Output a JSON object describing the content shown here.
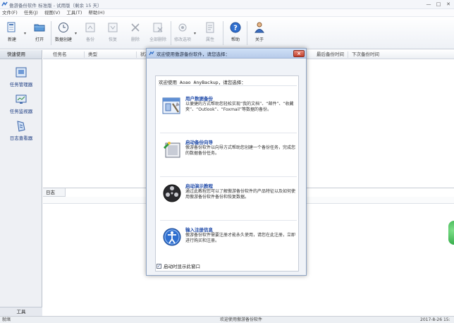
{
  "window": {
    "title": "傲游备份软件 标准版 - 试用版（剩余 15 天）",
    "controls": [
      "—",
      "□",
      "✕"
    ]
  },
  "menu": [
    "文件(F)",
    "任务(J)",
    "视图(V)",
    "工具(T)",
    "帮助(H)"
  ],
  "toolbar": {
    "buttons": [
      {
        "label": "新建",
        "icon": "new-task-icon",
        "disabled": false
      },
      {
        "label": "打开",
        "icon": "open-folder-icon",
        "disabled": false
      },
      {
        "label": "数据创建",
        "icon": "clock-icon",
        "disabled": false
      },
      {
        "label": "备份",
        "icon": "backup-icon",
        "disabled": true
      },
      {
        "label": "恢复",
        "icon": "restore-icon",
        "disabled": true
      },
      {
        "label": "删除",
        "icon": "delete-icon",
        "disabled": true
      },
      {
        "label": "全部删除",
        "icon": "delete-all-icon",
        "disabled": true
      },
      {
        "label": "修改选项",
        "icon": "settings-icon",
        "disabled": true
      },
      {
        "label": "属性",
        "icon": "properties-icon",
        "disabled": true
      },
      {
        "label": "帮助",
        "icon": "help-icon",
        "disabled": false
      },
      {
        "label": "关于",
        "icon": "about-icon",
        "disabled": false
      }
    ]
  },
  "sidebar": {
    "header": "快速使用",
    "items": [
      {
        "label": "任务管理器",
        "icon": "task-manager-icon"
      },
      {
        "label": "任务监视器",
        "icon": "task-monitor-icon"
      },
      {
        "label": "日志查看器",
        "icon": "log-viewer-icon"
      }
    ],
    "footer": "工具"
  },
  "table": {
    "columns": [
      "任务名",
      "类型",
      "状态",
      "最后备份时间",
      "下次备份时间"
    ]
  },
  "log": {
    "tab": "日志"
  },
  "status": {
    "left": "就绪",
    "middle": "欢迎使用傲游备份软件",
    "right": "2017-8-26 15:"
  },
  "dialog": {
    "title": "欢迎使用傲游备份软件，请您选择：",
    "prompt": "欢迎使用 Aoao AnyBackup，请您选择：",
    "options": [
      {
        "title": "用户数据备份",
        "desc": "以便捷的方式帮助您轻松实现“我的文档”、“邮件”、“收藏夹”、“Outlook”、“Foxmail”等数据的备份。",
        "icon": "user-data-backup-icon"
      },
      {
        "title": "启动备份向导",
        "desc": "傲游备份软件以向导方式帮助您创建一个备份任务，完成您的数据备份任务。",
        "icon": "backup-wizard-icon"
      },
      {
        "title": "启动演示教程",
        "desc": "通过此教程您可以了解傲游备份软件的产品特征以及如何使用傲游备份软件备份和恢复数据。",
        "icon": "tutorial-film-icon"
      },
      {
        "title": "输入注册信息",
        "desc": "傲游备份软件需要注册才能永久使用，请您在此注册，立即进行购买和注册。",
        "icon": "register-icon"
      }
    ],
    "checkbox_label": "启动时显示此窗口",
    "checkbox_checked": true
  }
}
